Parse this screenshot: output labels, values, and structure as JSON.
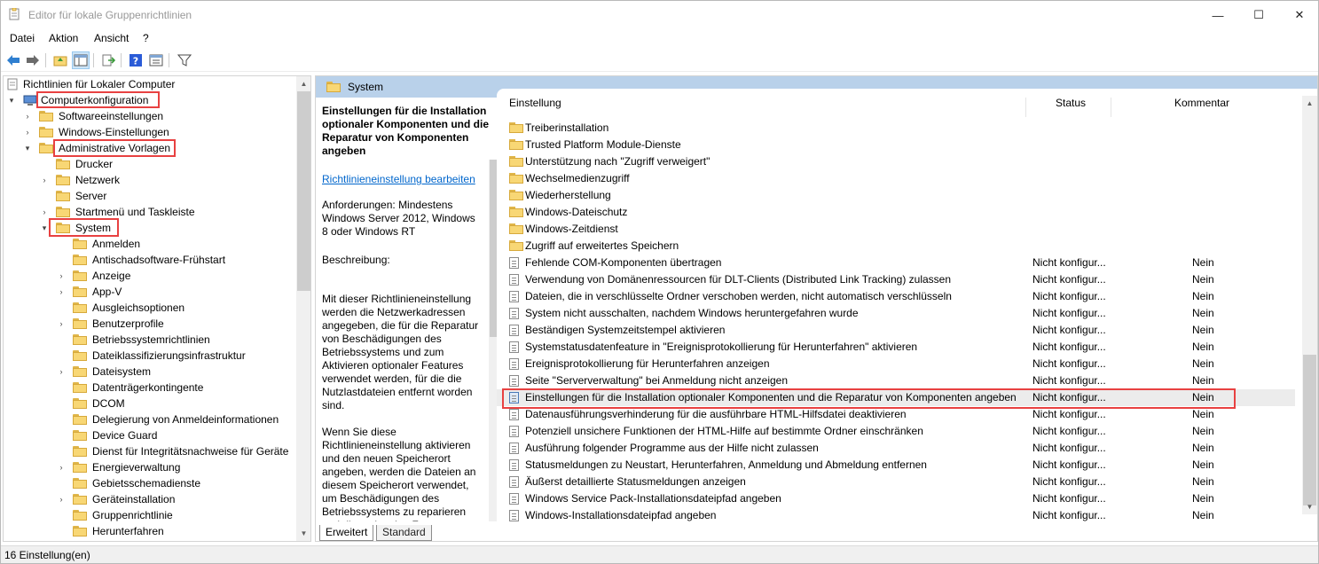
{
  "window": {
    "title": "Editor für lokale Gruppenrichtlinien",
    "controls": {
      "minimize": "—",
      "maximize": "☐",
      "close": "✕"
    }
  },
  "menubar": {
    "items": [
      "Datei",
      "Aktion",
      "Ansicht",
      "?"
    ]
  },
  "toolbar": {
    "icons": [
      "back-arrow-icon",
      "forward-arrow-icon",
      "folder-up-icon",
      "show-hide-tree-icon",
      "export-list-icon",
      "help-icon",
      "properties-icon",
      "filter-icon"
    ]
  },
  "tree": {
    "root": "Richtlinien für Lokaler Computer",
    "computer": "Computerkonfiguration",
    "software": "Softwareeinstellungen",
    "windows": "Windows-Einstellungen",
    "admin": "Administrative Vorlagen",
    "admin_children": [
      "Drucker",
      "Netzwerk",
      "Server",
      "Startmenü und Taskleiste",
      "System"
    ],
    "system_children": [
      "Anmelden",
      "Antischadsoftware-Frühstart",
      "Anzeige",
      "App-V",
      "Ausgleichsoptionen",
      "Benutzerprofile",
      "Betriebssystemrichtlinien",
      "Dateiklassifizierungsinfrastruktur",
      "Dateisystem",
      "Datenträgerkontingente",
      "DCOM",
      "Delegierung von Anmeldeinformationen",
      "Device Guard",
      "Dienst für Integritätsnachweise für Geräte",
      "Energieverwaltung",
      "Gebietsschemadienste",
      "Geräteinstallation",
      "Gruppenrichtlinie",
      "Herunterfahren"
    ]
  },
  "panel": {
    "header": "System",
    "description": {
      "title": "Einstellungen für die Installation optionaler Komponenten und die Reparatur von Komponenten angeben",
      "edit_link": "Richtlinieneinstellung bearbeiten",
      "requirements": "Anforderungen: Mindestens Windows Server 2012, Windows 8 oder Windows RT",
      "description_label": "Beschreibung:",
      "body1": "Mit dieser Richtlinieneinstellung werden die Netzwerkadressen angegeben, die für die Reparatur von Beschädigungen des Betriebssystems und zum Aktivieren optionaler Features verwendet werden, für die die Nutzlastdateien entfernt worden sind.",
      "body2": "Wenn Sie diese Richtlinieneinstellung aktivieren und den neuen Speicherort angeben, werden die Dateien an diesem Speicherort verwendet, um Beschädigungen des Betriebssystems zu reparieren und die optionalen Features zu"
    },
    "columns": {
      "setting": "Einstellung",
      "status": "Status",
      "comment": "Kommentar"
    },
    "folders": [
      "Treiberinstallation",
      "Trusted Platform Module-Dienste",
      "Unterstützung nach \"Zugriff verweigert\"",
      "Wechselmedienzugriff",
      "Wiederherstellung",
      "Windows-Dateischutz",
      "Windows-Zeitdienst",
      "Zugriff auf erweitertes Speichern"
    ],
    "settings": [
      {
        "name": "Fehlende COM-Komponenten übertragen",
        "status": "Nicht konfigur...",
        "comment": "Nein"
      },
      {
        "name": "Verwendung von Domänenressourcen für DLT-Clients (Distributed Link Tracking) zulassen",
        "status": "Nicht konfigur...",
        "comment": "Nein"
      },
      {
        "name": "Dateien, die in verschlüsselte Ordner verschoben werden, nicht automatisch verschlüsseln",
        "status": "Nicht konfigur...",
        "comment": "Nein"
      },
      {
        "name": "System nicht ausschalten, nachdem Windows heruntergefahren wurde",
        "status": "Nicht konfigur...",
        "comment": "Nein"
      },
      {
        "name": "Beständigen Systemzeitstempel aktivieren",
        "status": "Nicht konfigur...",
        "comment": "Nein"
      },
      {
        "name": "Systemstatusdatenfeature in \"Ereignisprotokollierung für Herunterfahren\" aktivieren",
        "status": "Nicht konfigur...",
        "comment": "Nein"
      },
      {
        "name": "Ereignisprotokollierung für Herunterfahren anzeigen",
        "status": "Nicht konfigur...",
        "comment": "Nein"
      },
      {
        "name": "Seite \"Serververwaltung\" bei Anmeldung nicht anzeigen",
        "status": "Nicht konfigur...",
        "comment": "Nein"
      },
      {
        "name": "Einstellungen für die Installation optionaler Komponenten und die Reparatur von Komponenten angeben",
        "status": "Nicht konfigur...",
        "comment": "Nein"
      },
      {
        "name": "Datenausführungsverhinderung für die ausführbare HTML-Hilfsdatei deaktivieren",
        "status": "Nicht konfigur...",
        "comment": "Nein"
      },
      {
        "name": "Potenziell unsichere Funktionen der HTML-Hilfe auf bestimmte Ordner einschränken",
        "status": "Nicht konfigur...",
        "comment": "Nein"
      },
      {
        "name": "Ausführung folgender Programme aus der Hilfe nicht zulassen",
        "status": "Nicht konfigur...",
        "comment": "Nein"
      },
      {
        "name": "Statusmeldungen zu Neustart, Herunterfahren, Anmeldung und Abmeldung entfernen",
        "status": "Nicht konfigur...",
        "comment": "Nein"
      },
      {
        "name": "Äußerst detaillierte Statusmeldungen anzeigen",
        "status": "Nicht konfigur...",
        "comment": "Nein"
      },
      {
        "name": "Windows Service Pack-Installationsdateipfad angeben",
        "status": "Nicht konfigur...",
        "comment": "Nein"
      },
      {
        "name": "Windows-Installationsdateipfad angeben",
        "status": "Nicht konfigur...",
        "comment": "Nein"
      }
    ],
    "tabs": [
      "Erweitert",
      "Standard"
    ]
  },
  "statusbar": {
    "text": "16 Einstellung(en)"
  },
  "colors": {
    "highlight": "#e84141",
    "header_bg": "#b9d1ea",
    "folder": "#f8d775",
    "link": "#0066cc"
  }
}
